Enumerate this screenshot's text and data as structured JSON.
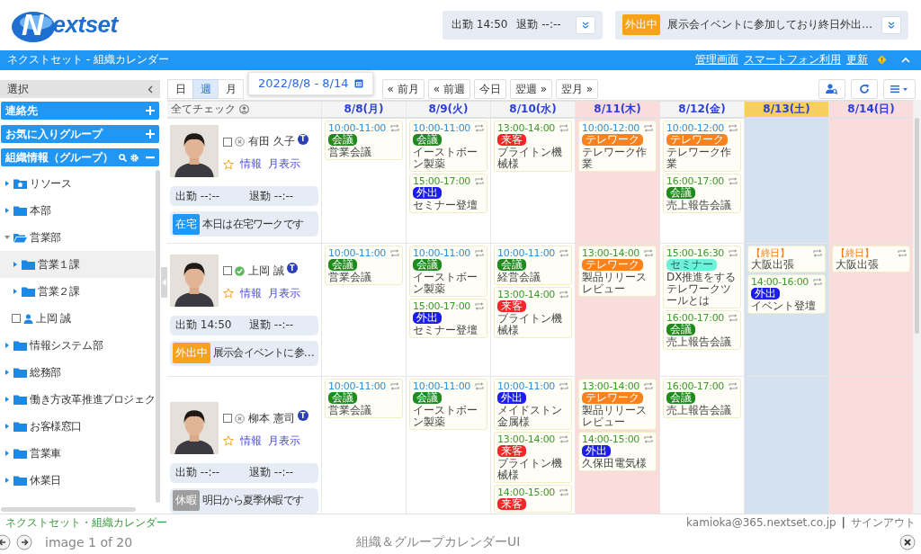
{
  "logo": "Nextset",
  "attendance_panel": {
    "clock_in": "出勤 14:50",
    "clock_out": "退勤 --:--"
  },
  "status_panel": {
    "badge": "外出中",
    "color": "#f7a21b",
    "message": "展示会イベントに参加しており終日外出…"
  },
  "title_bar": {
    "title": "ネクストセット - 組織カレンダー",
    "links": [
      "管理画面",
      "スマートフォン利用",
      "更新"
    ]
  },
  "sidebar": {
    "header": "選択",
    "panels": [
      {
        "label": "連絡先",
        "kind": "add"
      },
      {
        "label": "お気に入りグループ",
        "kind": "add"
      },
      {
        "label": "組織情報（グループ）",
        "kind": "tools"
      }
    ],
    "tree": [
      {
        "label": "リソース",
        "kind": "resource",
        "expanded": false,
        "selected": false
      },
      {
        "label": "本部",
        "kind": "folder",
        "expanded": false,
        "selected": false
      },
      {
        "label": "営業部",
        "kind": "folder",
        "expanded": true,
        "selected": false,
        "children": [
          {
            "label": "営業１課",
            "kind": "folder",
            "expanded": false,
            "selected": true
          },
          {
            "label": "営業２課",
            "kind": "folder",
            "expanded": false,
            "selected": false
          },
          {
            "label": "上岡 誠",
            "kind": "person",
            "checked": false,
            "selected": false
          }
        ]
      },
      {
        "label": "情報システム部",
        "kind": "folder",
        "expanded": false,
        "selected": false
      },
      {
        "label": "総務部",
        "kind": "folder",
        "expanded": false,
        "selected": false
      },
      {
        "label": "働き方改革推進プロジェク",
        "kind": "folder",
        "expanded": false,
        "selected": false
      },
      {
        "label": "お客様窓口",
        "kind": "folder",
        "expanded": false,
        "selected": false
      },
      {
        "label": "営業車",
        "kind": "folder",
        "expanded": false,
        "selected": false
      },
      {
        "label": "休業日",
        "kind": "folder",
        "expanded": false,
        "selected": false
      }
    ]
  },
  "toolbar": {
    "views": [
      {
        "label": "日",
        "selected": false
      },
      {
        "label": "週",
        "selected": true
      },
      {
        "label": "月",
        "selected": false
      }
    ],
    "date_range": "2022/8/8 - 8/14",
    "nav": [
      "« 前月",
      "« 前週",
      "今日",
      "翌週 »",
      "翌月 »"
    ]
  },
  "calendar": {
    "check_all": "全てチェック",
    "days": [
      {
        "label": "8/8(月)",
        "kind": "weekday",
        "today": false
      },
      {
        "label": "8/9(火)",
        "kind": "weekday",
        "today": false
      },
      {
        "label": "8/10(水)",
        "kind": "weekday",
        "today": false
      },
      {
        "label": "8/11(木)",
        "kind": "holiday",
        "today": false
      },
      {
        "label": "8/12(金)",
        "kind": "weekday",
        "today": false
      },
      {
        "label": "8/13(土)",
        "kind": "saturday",
        "today": true
      },
      {
        "label": "8/14(日)",
        "kind": "sunday",
        "today": false
      }
    ],
    "people": [
      {
        "name": "有田 久子",
        "checked": false,
        "present": false,
        "tag": "T",
        "links": [
          "情報",
          "月表示"
        ],
        "clock_in": "出勤 --:--",
        "clock_out": "退勤 --:--",
        "status": {
          "badge": "在宅",
          "color": "#2196f3",
          "message": "本日は在宅ワークです"
        },
        "days": [
          [
            {
              "time": "10:00-11:00",
              "kind": "am",
              "tag": "会議",
              "color": "#1f8a1f",
              "title": "営業会議"
            }
          ],
          [
            {
              "time": "10:00-11:00",
              "kind": "am",
              "tag": "会議",
              "color": "#1f8a1f",
              "title": "イーストボーン製薬"
            },
            {
              "time": "15:00-17:00",
              "kind": "pm",
              "tag": "外出",
              "color": "#1d1df0",
              "title": "セミナー登壇"
            }
          ],
          [
            {
              "time": "13:00-14:00",
              "kind": "pm",
              "tag": "来客",
              "color": "#f02828",
              "title": "ブライトン機械様"
            }
          ],
          [
            {
              "time": "10:00-12:00",
              "kind": "am",
              "tag": "テレワーク",
              "color": "#f7821e",
              "title": "テレワーク作業"
            }
          ],
          [
            {
              "time": "10:00-12:00",
              "kind": "am",
              "tag": "テレワーク",
              "color": "#f7821e",
              "title": "テレワーク作業"
            },
            {
              "time": "16:00-17:00",
              "kind": "pm",
              "tag": "会議",
              "color": "#1f8a1f",
              "title": "売上報告会議"
            }
          ]
        ]
      },
      {
        "name": "上岡 誠",
        "checked": false,
        "present": true,
        "tag": "T",
        "links": [
          "情報",
          "月表示"
        ],
        "clock_in": "出勤 14:50",
        "clock_out": "退勤 --:--",
        "status": {
          "badge": "外出中",
          "color": "#f7a21b",
          "message": "展示会イベントに参…"
        },
        "days": [
          [
            {
              "time": "10:00-11:00",
              "kind": "am",
              "tag": "会議",
              "color": "#1f8a1f",
              "title": "営業会議"
            }
          ],
          [
            {
              "time": "10:00-11:00",
              "kind": "am",
              "tag": "会議",
              "color": "#1f8a1f",
              "title": "イーストボーン製薬"
            },
            {
              "time": "15:00-17:00",
              "kind": "pm",
              "tag": "外出",
              "color": "#1d1df0",
              "title": "セミナー登壇"
            }
          ],
          [
            {
              "time": "10:00-11:00",
              "kind": "am",
              "tag": "会議",
              "color": "#1f8a1f",
              "title": "経営会議"
            },
            {
              "time": "13:00-14:00",
              "kind": "pm",
              "tag": "来客",
              "color": "#f02828",
              "title": "ブライトン機械様"
            }
          ],
          [
            {
              "time": "13:00-14:00",
              "kind": "pm",
              "tag": "テレワーク",
              "color": "#f7821e",
              "title": "製品リリースレビュー"
            }
          ],
          [
            {
              "time": "15:00-16:30",
              "kind": "pm",
              "tag": "セミナー",
              "color": "#6ff0d8",
              "title": "DX推進をするテレワークツールとは"
            },
            {
              "time": "16:00-17:00",
              "kind": "pm",
              "tag": "会議",
              "color": "#1f8a1f",
              "title": "売上報告会議"
            }
          ],
          [
            {
              "time": "【終日】",
              "kind": "allday",
              "title": "大阪出張"
            },
            {
              "time": "14:00-16:00",
              "kind": "pm",
              "tag": "外出",
              "color": "#1d1df0",
              "title": "イベント登壇"
            }
          ],
          [
            {
              "time": "【終日】",
              "kind": "allday",
              "title": "大阪出張"
            }
          ]
        ]
      },
      {
        "name": "柳本 憲司",
        "checked": false,
        "present": false,
        "tag": "T",
        "links": [
          "情報",
          "月表示"
        ],
        "clock_in": "出勤 --:--",
        "clock_out": "退勤 --:--",
        "status": {
          "badge": "休暇",
          "color": "#9e9e9e",
          "message": "明日から夏季休暇です"
        },
        "days": [
          [
            {
              "time": "10:00-11:00",
              "kind": "am",
              "tag": "会議",
              "color": "#1f8a1f",
              "title": "営業会議"
            }
          ],
          [
            {
              "time": "10:00-11:00",
              "kind": "am",
              "tag": "会議",
              "color": "#1f8a1f",
              "title": "イーストボーン製薬"
            }
          ],
          [
            {
              "time": "10:00-11:00",
              "kind": "am",
              "tag": "外出",
              "color": "#1d1df0",
              "title": "メイドストン金属様"
            },
            {
              "time": "13:00-14:00",
              "kind": "pm",
              "tag": "来客",
              "color": "#f02828",
              "title": "ブライトン機械様"
            },
            {
              "time": "14:00-15:00",
              "kind": "pm",
              "tag": "来客",
              "color": "#f02828"
            }
          ],
          [
            {
              "time": "13:00-14:00",
              "kind": "pm",
              "tag": "テレワーク",
              "color": "#f7821e",
              "title": "製品リリースレビュー"
            },
            {
              "time": "14:00-15:00",
              "kind": "pm",
              "tag": "外出",
              "color": "#1d1df0",
              "title": "久保田電気様"
            }
          ],
          [
            {
              "time": "16:00-17:00",
              "kind": "pm",
              "tag": "会議",
              "color": "#1f8a1f",
              "title": "売上報告会議"
            }
          ]
        ]
      }
    ]
  },
  "footer": {
    "app": "ネクストセット・組織カレンダー",
    "user": "kamioka@365.nextset.co.jp",
    "separator": "|",
    "sign_out": "サインアウト"
  },
  "viewer": {
    "counter": "image 1 of 20",
    "caption": "組織＆グループカレンダーUI"
  }
}
